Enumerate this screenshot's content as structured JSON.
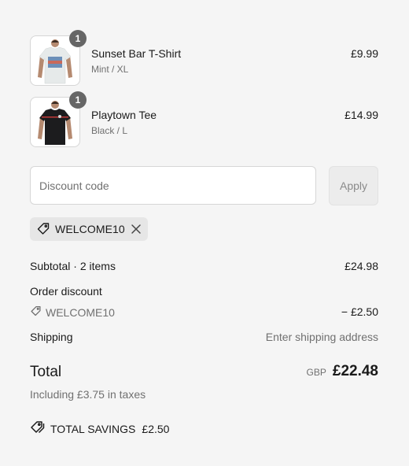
{
  "items": [
    {
      "name": "Sunset Bar T-Shirt",
      "variant": "Mint / XL",
      "price": "£9.99",
      "quantity": "1",
      "shirt_color": "#e8ecec"
    },
    {
      "name": "Playtown Tee",
      "variant": "Black / L",
      "price": "£14.99",
      "quantity": "1",
      "shirt_color": "#1c1c1e"
    }
  ],
  "discount": {
    "placeholder": "Discount code",
    "apply_label": "Apply",
    "applied_code": "WELCOME10"
  },
  "summary": {
    "subtotal_label": "Subtotal · 2 items",
    "subtotal_value": "£24.98",
    "order_discount_label": "Order discount",
    "discount_code": "WELCOME10",
    "discount_value": "− £2.50",
    "shipping_label": "Shipping",
    "shipping_value": "Enter shipping address",
    "total_label": "Total",
    "currency": "GBP",
    "total_value": "£22.48",
    "tax_note": "Including £3.75 in taxes",
    "savings_label": "TOTAL SAVINGS",
    "savings_value": "£2.50"
  },
  "icons": {
    "tag": "tag-icon",
    "close": "close-icon",
    "savings": "tag-icon"
  }
}
